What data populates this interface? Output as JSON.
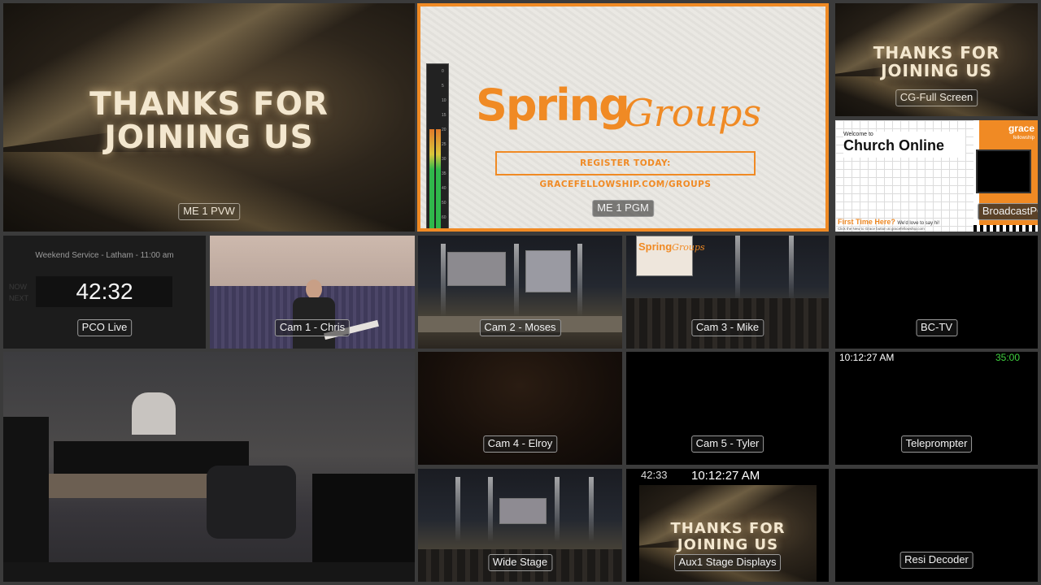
{
  "labels": {
    "me1_pvw": "ME 1 PVW",
    "me1_pgm": "ME 1 PGM",
    "cg_full_screen": "CG-Full Screen",
    "broadcast_pgm": "BroadcastPGM",
    "pco_live": "PCO Live",
    "cam1": "Cam 1 - Chris",
    "cam2": "Cam 2 - Moses",
    "cam3": "Cam 3 - Mike",
    "bctv": "BC-TV",
    "cam4": "Cam 4 - Elroy",
    "cam5": "Cam 5 - Tyler",
    "teleprompter": "Teleprompter",
    "wide_stage": "Wide Stage",
    "aux1": "Aux1 Stage Displays",
    "resi": "Resi Decoder"
  },
  "graphics": {
    "thanks_line1": "THANKS FOR",
    "thanks_line2": "JOINING US",
    "spring": "Spring",
    "groups": "Groups",
    "register": "REGISTER TODAY: GRACEFELLOWSHIP.COM/GROUPS",
    "church_online_welcome": "Welcome to",
    "church_online_title": "Church Online",
    "grace_logo": "grace",
    "grace_logo_sub": "fellowship",
    "first_time": "First Time Here?",
    "first_time_sub": "We'd love to say hi!",
    "first_time_small": "Click the New to Grace button at gracefellowship.com"
  },
  "pco": {
    "service": "Weekend Service - Latham - 11:00 am",
    "countdown": "42:32",
    "now": "NOW",
    "next": "NEXT"
  },
  "teleprompter": {
    "clock": "10:12:27 AM",
    "timer": "35:00"
  },
  "aux1": {
    "countdown": "42:33",
    "clock": "10:12:27 AM"
  },
  "meter": {
    "scale": [
      "0",
      "5",
      "10",
      "15",
      "20",
      "25",
      "30",
      "35",
      "40",
      "50",
      "60"
    ],
    "left_level": 0.62,
    "right_level": 0.62
  },
  "colors": {
    "accent_orange": "#f08a24",
    "timer_green": "#3fd13f",
    "pgm_border": "#f08a24"
  }
}
